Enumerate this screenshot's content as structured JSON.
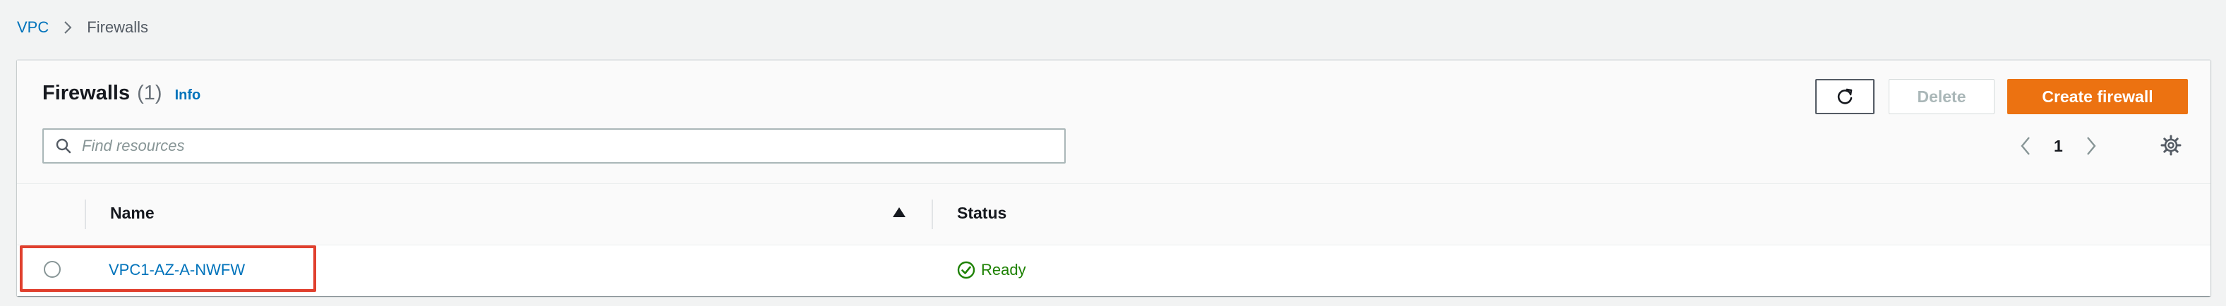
{
  "breadcrumb": {
    "root": "VPC",
    "current": "Firewalls"
  },
  "header": {
    "title": "Firewalls",
    "count": "(1)",
    "info": "Info"
  },
  "buttons": {
    "delete": "Delete",
    "create": "Create firewall"
  },
  "search": {
    "placeholder": "Find resources",
    "value": ""
  },
  "pagination": {
    "current_page": "1"
  },
  "table": {
    "columns": {
      "name": "Name",
      "status": "Status"
    },
    "sort": {
      "column": "Name",
      "direction": "ascending"
    },
    "rows": [
      {
        "name": "VPC1-AZ-A-NWFW",
        "status": "Ready",
        "selected": false
      }
    ]
  },
  "icons": {
    "breadcrumb_separator": "chevron-right-icon",
    "refresh": "refresh-icon",
    "search": "search-icon",
    "pagination_prev": "chevron-left-icon",
    "pagination_next": "chevron-right-icon",
    "settings": "gear-icon",
    "sort": "caret-up-icon",
    "status": "check-circle-icon"
  },
  "colors": {
    "link": "#0073bb",
    "primary_button": "#ec7211",
    "success": "#1d8102",
    "highlight": "#e0402e",
    "background": "#f2f3f3"
  }
}
